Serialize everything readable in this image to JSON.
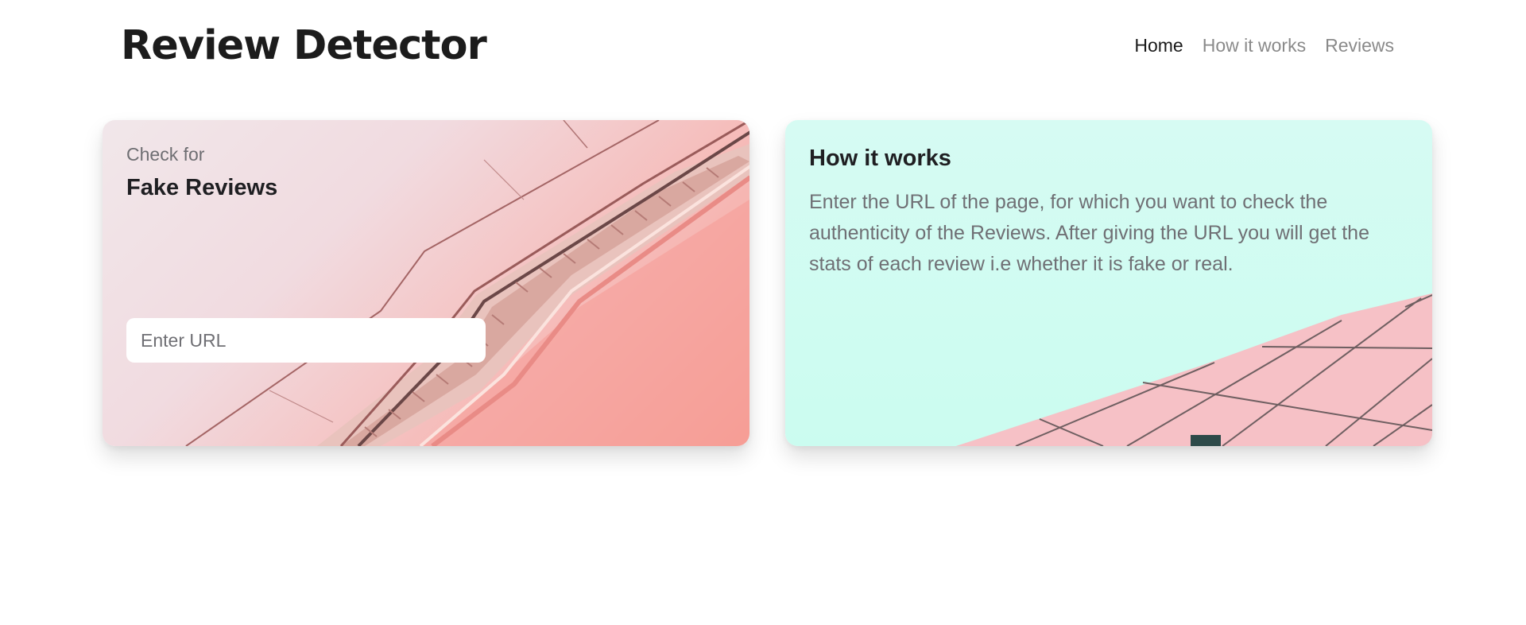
{
  "header": {
    "brand": "Review Detector",
    "nav": [
      {
        "label": "Home",
        "active": true
      },
      {
        "label": "How it works",
        "active": false
      },
      {
        "label": "Reviews",
        "active": false
      }
    ]
  },
  "check_card": {
    "eyebrow": "Check for",
    "title": "Fake Reviews",
    "url_placeholder": "Enter URL",
    "url_value": ""
  },
  "how_card": {
    "title": "How it works",
    "description": "Enter the URL of the page, for which you want to check the authenticity of the Reviews. After giving the URL you will get the stats of each review i.e whether it is fake or real."
  },
  "colors": {
    "left_card_gradient_start": "#f1e7ea",
    "left_card_gradient_end": "#f7a196",
    "right_card_background": "#cbfcf0",
    "brand_text": "#1c1c1c",
    "nav_inactive": "#8a8a8a"
  }
}
